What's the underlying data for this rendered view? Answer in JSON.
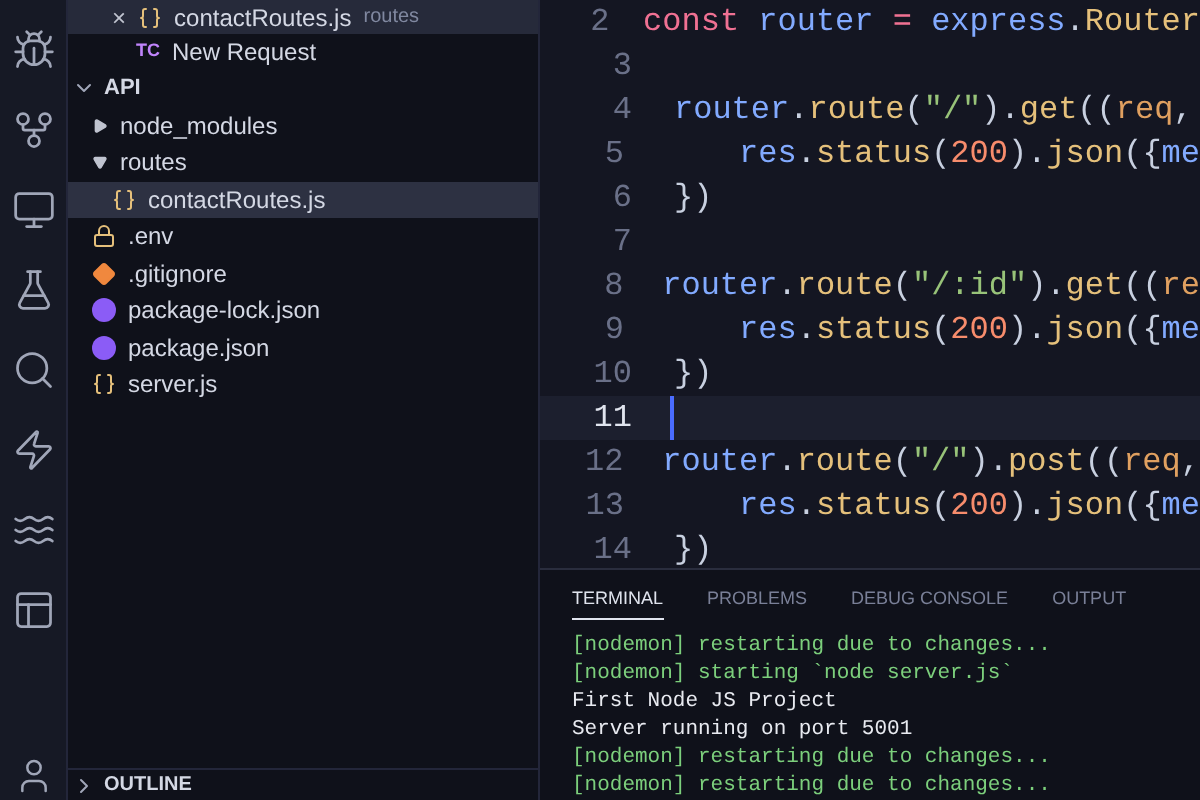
{
  "open_editors": [
    {
      "name": "contactRoutes.js",
      "description": "routes",
      "kind": "js",
      "close": "×",
      "selected": true
    },
    {
      "name": "New Request",
      "kind": "tc",
      "badge": "TC",
      "selected": false
    }
  ],
  "explorer": {
    "name": "API",
    "expanded": true,
    "children": [
      {
        "name": "node_modules",
        "kind": "folder",
        "expanded": false
      },
      {
        "name": "routes",
        "kind": "folder",
        "expanded": true,
        "children": [
          {
            "name": "contactRoutes.js",
            "kind": "js",
            "selected": true
          }
        ]
      },
      {
        "name": ".env",
        "kind": "env",
        "selected": false
      },
      {
        "name": ".gitignore",
        "kind": "git",
        "selected": false
      },
      {
        "name": "package-lock.json",
        "kind": "npm",
        "selected": false
      },
      {
        "name": "package.json",
        "kind": "npm",
        "selected": false
      },
      {
        "name": "server.js",
        "kind": "js",
        "selected": false
      }
    ]
  },
  "outline": {
    "label": "OUTLINE",
    "expanded": false
  },
  "editor": {
    "lines": [
      {
        "number": "2",
        "current": false,
        "tokens": [
          {
            "kind": "keyword",
            "text": "const "
          },
          {
            "kind": "var",
            "text": "router "
          },
          {
            "kind": "keyword",
            "text": "= "
          },
          {
            "kind": "var",
            "text": "express"
          },
          {
            "kind": "punct",
            "text": "."
          },
          {
            "kind": "fn",
            "text": "Router"
          }
        ]
      },
      {
        "number": "3",
        "current": false
      },
      {
        "number": "4",
        "current": false,
        "tokens": [
          {
            "kind": "var",
            "text": "router"
          },
          {
            "kind": "punct",
            "text": "."
          },
          {
            "kind": "fn",
            "text": "route"
          },
          {
            "kind": "punct",
            "text": "("
          },
          {
            "kind": "string",
            "text": "\"/\""
          },
          {
            "kind": "punct",
            "text": ")."
          },
          {
            "kind": "fn",
            "text": "get"
          },
          {
            "kind": "punct",
            "text": "(("
          },
          {
            "kind": "param",
            "text": "req"
          },
          {
            "kind": "punct",
            "text": ","
          }
        ]
      },
      {
        "number": "5",
        "current": false,
        "indented": true,
        "tokens": [
          {
            "kind": "var",
            "text": "res"
          },
          {
            "kind": "punct",
            "text": "."
          },
          {
            "kind": "fn",
            "text": "status"
          },
          {
            "kind": "punct",
            "text": "("
          },
          {
            "kind": "number",
            "text": "200"
          },
          {
            "kind": "punct",
            "text": ")."
          },
          {
            "kind": "fn",
            "text": "json"
          },
          {
            "kind": "punct",
            "text": "({"
          },
          {
            "kind": "var",
            "text": "me"
          }
        ]
      },
      {
        "number": "6",
        "current": false,
        "tokens": [
          {
            "kind": "punct",
            "text": "})"
          }
        ]
      },
      {
        "number": "7",
        "current": false
      },
      {
        "number": "8",
        "current": false,
        "tokens": [
          {
            "kind": "var",
            "text": "router"
          },
          {
            "kind": "punct",
            "text": "."
          },
          {
            "kind": "fn",
            "text": "route"
          },
          {
            "kind": "punct",
            "text": "("
          },
          {
            "kind": "string",
            "text": "\"/:id\""
          },
          {
            "kind": "punct",
            "text": ")."
          },
          {
            "kind": "fn",
            "text": "get"
          },
          {
            "kind": "punct",
            "text": "(("
          },
          {
            "kind": "param",
            "text": "re"
          }
        ]
      },
      {
        "number": "9",
        "current": false,
        "indented": true,
        "tokens": [
          {
            "kind": "var",
            "text": "res"
          },
          {
            "kind": "punct",
            "text": "."
          },
          {
            "kind": "fn",
            "text": "status"
          },
          {
            "kind": "punct",
            "text": "("
          },
          {
            "kind": "number",
            "text": "200"
          },
          {
            "kind": "punct",
            "text": ")."
          },
          {
            "kind": "fn",
            "text": "json"
          },
          {
            "kind": "punct",
            "text": "({"
          },
          {
            "kind": "var",
            "text": "me"
          }
        ]
      },
      {
        "number": "10",
        "current": false,
        "tokens": [
          {
            "kind": "punct",
            "text": "})"
          }
        ]
      },
      {
        "number": "11",
        "current": true
      },
      {
        "number": "12",
        "current": false,
        "tokens": [
          {
            "kind": "var",
            "text": "router"
          },
          {
            "kind": "punct",
            "text": "."
          },
          {
            "kind": "fn",
            "text": "route"
          },
          {
            "kind": "punct",
            "text": "("
          },
          {
            "kind": "string",
            "text": "\"/\""
          },
          {
            "kind": "punct",
            "text": ")."
          },
          {
            "kind": "fn",
            "text": "post"
          },
          {
            "kind": "punct",
            "text": "(("
          },
          {
            "kind": "param",
            "text": "req"
          },
          {
            "kind": "punct",
            "text": ","
          }
        ]
      },
      {
        "number": "13",
        "current": false,
        "indented": true,
        "tokens": [
          {
            "kind": "var",
            "text": "res"
          },
          {
            "kind": "punct",
            "text": "."
          },
          {
            "kind": "fn",
            "text": "status"
          },
          {
            "kind": "punct",
            "text": "("
          },
          {
            "kind": "number",
            "text": "200"
          },
          {
            "kind": "punct",
            "text": ")."
          },
          {
            "kind": "fn",
            "text": "json"
          },
          {
            "kind": "punct",
            "text": "({"
          },
          {
            "kind": "var",
            "text": "me"
          }
        ]
      },
      {
        "number": "14",
        "current": false,
        "tokens": [
          {
            "kind": "punct",
            "text": "})"
          }
        ]
      }
    ]
  },
  "panel": {
    "tabs": [
      {
        "label": "TERMINAL",
        "selected": true
      },
      {
        "label": "PROBLEMS",
        "selected": false
      },
      {
        "label": "DEBUG CONSOLE",
        "selected": false
      },
      {
        "label": "OUTPUT",
        "selected": false
      }
    ],
    "lines": [
      {
        "kind": "nodemon",
        "text": "[nodemon] restarting due to changes..."
      },
      {
        "kind": "nodemon",
        "text": "[nodemon] starting `node server.js`"
      },
      {
        "kind": "plain",
        "text": "First Node JS Project"
      },
      {
        "kind": "plain",
        "text": "Server running on port 5001"
      },
      {
        "kind": "nodemon",
        "text": "[nodemon] restarting due to changes..."
      },
      {
        "kind": "nodemon",
        "text": "[nodemon] restarting due to changes..."
      }
    ]
  }
}
